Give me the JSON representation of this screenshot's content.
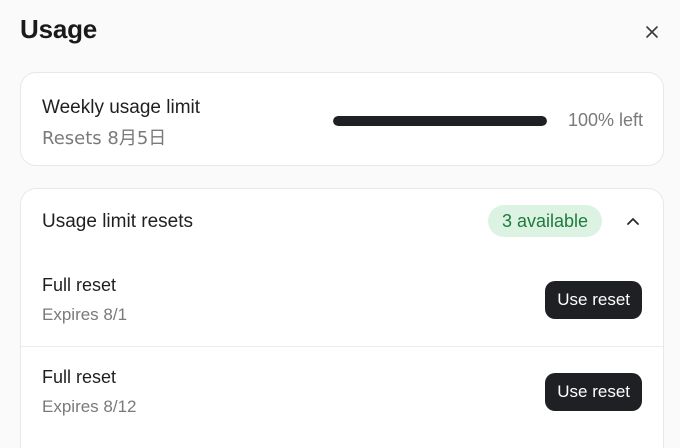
{
  "title": "Usage",
  "weekly": {
    "label": "Weekly usage limit",
    "resets": "Resets 8月5日",
    "progress_left_fraction": 1.0,
    "left_text": "100% left"
  },
  "resets_card": {
    "header": "Usage limit resets",
    "badge": "3 available",
    "items": [
      {
        "title": "Full reset",
        "expires": "Expires 8/1",
        "button": "Use reset"
      },
      {
        "title": "Full reset",
        "expires": "Expires 8/12",
        "button": "Use reset"
      }
    ]
  },
  "icons": {
    "close": "close-icon",
    "collapse": "chevron-up-icon"
  },
  "colors": {
    "bar_fill": "#1f2023",
    "badge_bg": "#dcf3e3",
    "badge_text": "#1f7a3b",
    "button_bg": "#1f2023"
  }
}
